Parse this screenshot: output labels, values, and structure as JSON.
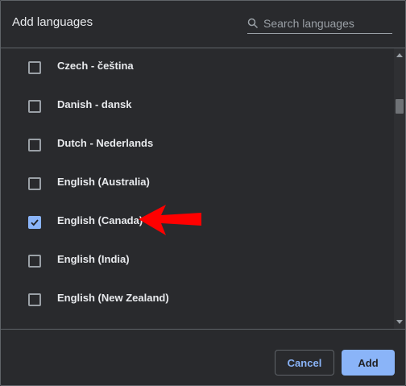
{
  "dialog": {
    "title": "Add languages",
    "search": {
      "placeholder": "Search languages",
      "value": ""
    }
  },
  "languages": [
    {
      "label": "Czech - čeština",
      "checked": false
    },
    {
      "label": "Danish - dansk",
      "checked": false
    },
    {
      "label": "Dutch - Nederlands",
      "checked": false
    },
    {
      "label": "English (Australia)",
      "checked": false
    },
    {
      "label": "English (Canada)",
      "checked": true
    },
    {
      "label": "English (India)",
      "checked": false
    },
    {
      "label": "English (New Zealand)",
      "checked": false
    }
  ],
  "buttons": {
    "cancel": "Cancel",
    "add": "Add"
  },
  "colors": {
    "accent": "#8ab4f8",
    "background": "#292a2d",
    "annotation_arrow": "#ff0000"
  }
}
